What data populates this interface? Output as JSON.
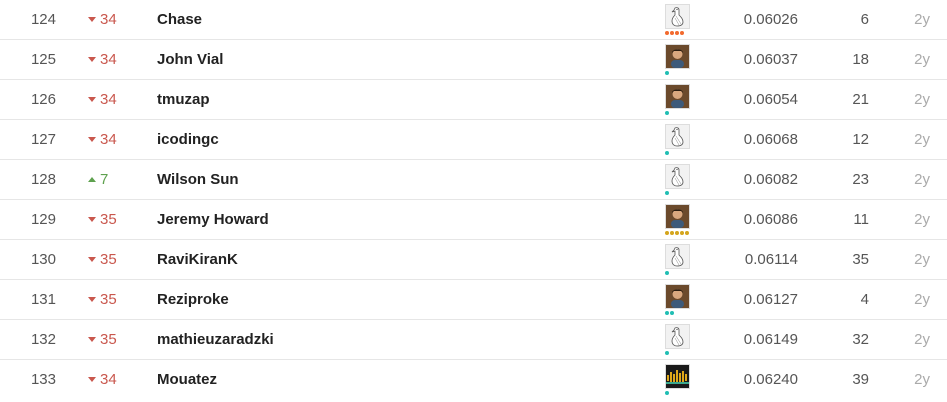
{
  "leaderboard": {
    "rows": [
      {
        "rank": "124",
        "change": "34",
        "direction": "down",
        "team": "Chase",
        "avatar": "goose-icon",
        "dots_color": "#f26a2e",
        "dots": 4,
        "score": "0.06026",
        "entries": "6",
        "last": "2y"
      },
      {
        "rank": "125",
        "change": "34",
        "direction": "down",
        "team": "John Vial",
        "avatar": "user-photo-icon",
        "dots_color": "#20beb4",
        "dots": 1,
        "score": "0.06037",
        "entries": "18",
        "last": "2y"
      },
      {
        "rank": "126",
        "change": "34",
        "direction": "down",
        "team": "tmuzap",
        "avatar": "user-photo-icon",
        "dots_color": "#20beb4",
        "dots": 1,
        "score": "0.06054",
        "entries": "21",
        "last": "2y"
      },
      {
        "rank": "127",
        "change": "34",
        "direction": "down",
        "team": "icodingc",
        "avatar": "goose-icon",
        "dots_color": "#20beb4",
        "dots": 1,
        "score": "0.06068",
        "entries": "12",
        "last": "2y"
      },
      {
        "rank": "128",
        "change": "7",
        "direction": "up",
        "team": "Wilson Sun",
        "avatar": "goose-icon",
        "dots_color": "#20beb4",
        "dots": 1,
        "score": "0.06082",
        "entries": "23",
        "last": "2y"
      },
      {
        "rank": "129",
        "change": "35",
        "direction": "down",
        "team": "Jeremy Howard",
        "avatar": "user-photo-icon",
        "dots_color": "#d4a51c",
        "dots": 5,
        "score": "0.06086",
        "entries": "11",
        "last": "2y"
      },
      {
        "rank": "130",
        "change": "35",
        "direction": "down",
        "team": "RaviKiranK",
        "avatar": "goose-icon",
        "dots_color": "#20beb4",
        "dots": 1,
        "score": "0.06114",
        "entries": "35",
        "last": "2y"
      },
      {
        "rank": "131",
        "change": "35",
        "direction": "down",
        "team": "Reziproke",
        "avatar": "user-photo-icon",
        "dots_color": "#20beb4",
        "dots": 2,
        "score": "0.06127",
        "entries": "4",
        "last": "2y"
      },
      {
        "rank": "132",
        "change": "35",
        "direction": "down",
        "team": "mathieuzaradzki",
        "avatar": "goose-icon",
        "dots_color": "#20beb4",
        "dots": 1,
        "score": "0.06149",
        "entries": "32",
        "last": "2y"
      },
      {
        "rank": "133",
        "change": "34",
        "direction": "down",
        "team": "Mouatez",
        "avatar": "waveform-image-icon",
        "dots_color": "#20beb4",
        "dots": 1,
        "score": "0.06240",
        "entries": "39",
        "last": "2y"
      }
    ]
  }
}
